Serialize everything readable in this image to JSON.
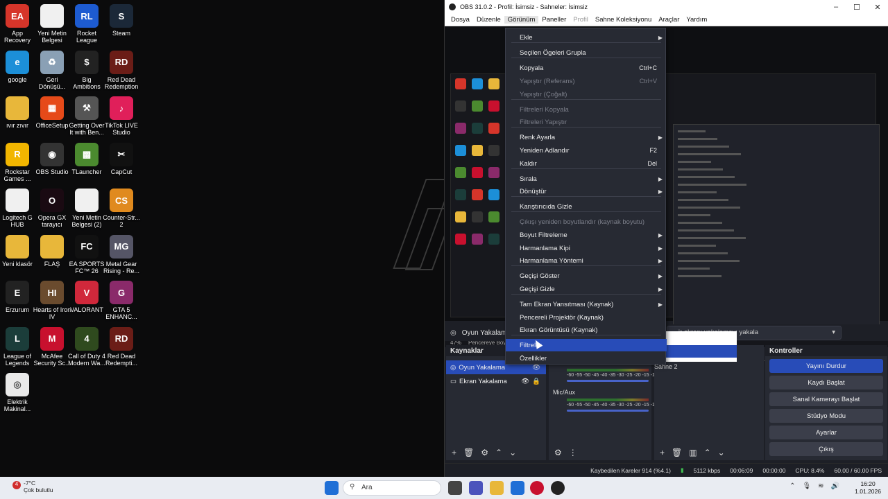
{
  "desktop": {
    "icons": [
      {
        "label": "App\nRecovery",
        "color": "#d6352a",
        "glyph": "EA"
      },
      {
        "label": "Yeni Metin\nBelgesi",
        "color": "#f0f0f0",
        "glyph": ""
      },
      {
        "label": "Rocket\nLeague",
        "color": "#1d5bd1",
        "glyph": "RL"
      },
      {
        "label": "Steam",
        "color": "#1b2838",
        "glyph": "S"
      },
      {
        "label": "google",
        "color": "#1c8fd8",
        "glyph": "e"
      },
      {
        "label": "Geri\nDönüşü...",
        "color": "#8aa0b5",
        "glyph": "♻"
      },
      {
        "label": "Big\nAmbitions",
        "color": "#222",
        "glyph": "$"
      },
      {
        "label": "Red Dead\nRedemption",
        "color": "#6b1d17",
        "glyph": "RD"
      },
      {
        "label": "ıvır zıvır",
        "color": "#e8b73a",
        "glyph": ""
      },
      {
        "label": "OfficeSetup",
        "color": "#e64a19",
        "glyph": "▦"
      },
      {
        "label": "Getting Over\nIt with Ben...",
        "color": "#555",
        "glyph": "⚒"
      },
      {
        "label": "TikTok LIVE\nStudio",
        "color": "#e01f5a",
        "glyph": "♪"
      },
      {
        "label": "Rockstar\nGames ...",
        "color": "#f2b600",
        "glyph": "R"
      },
      {
        "label": "OBS Studio",
        "color": "#333",
        "glyph": "◉"
      },
      {
        "label": "TLauncher",
        "color": "#4b8a2f",
        "glyph": "▩"
      },
      {
        "label": "CapCut",
        "color": "#111",
        "glyph": "✂"
      },
      {
        "label": "Logitech G\nHUB",
        "color": "#f0f0f0",
        "glyph": ""
      },
      {
        "label": "Opera GX\ntarayıcı",
        "color": "#1a0a12",
        "glyph": "O"
      },
      {
        "label": "Yeni Metin\nBelgesi (2)",
        "color": "#f0f0f0",
        "glyph": ""
      },
      {
        "label": "Counter-Str...\n2",
        "color": "#e08a1e",
        "glyph": "CS"
      },
      {
        "label": "Yeni klasör",
        "color": "#e8b73a",
        "glyph": ""
      },
      {
        "label": "FLAŞ",
        "color": "#e8b73a",
        "glyph": ""
      },
      {
        "label": "EA SPORTS\nFC™ 26",
        "color": "#111",
        "glyph": "FC"
      },
      {
        "label": "Metal Gear\nRising - Re...",
        "color": "#556",
        "glyph": "MG"
      },
      {
        "label": "Erzurum",
        "color": "#222",
        "glyph": "E"
      },
      {
        "label": "Hearts of Iron\nIV",
        "color": "#6a4b2e",
        "glyph": "HI"
      },
      {
        "label": "VALORANT",
        "color": "#d0283b",
        "glyph": "V"
      },
      {
        "label": "GTA 5\nENHANC...",
        "color": "#8a2a6a",
        "glyph": "G"
      },
      {
        "label": "League of\nLegends",
        "color": "#1b3d3a",
        "glyph": "L"
      },
      {
        "label": "McAfee\nSecurity Sc...",
        "color": "#c8102e",
        "glyph": "M"
      },
      {
        "label": "Call of Duty 4\nModern Wa...",
        "color": "#2f4a1e",
        "glyph": "4"
      },
      {
        "label": "Red Dead\nRedempti...",
        "color": "#6b1d17",
        "glyph": "RD"
      },
      {
        "label": "Elektrik\nMakinal...",
        "color": "#e9e9e9",
        "glyph": "◎"
      }
    ]
  },
  "obs": {
    "title": "OBS 31.0.2 - Profil: İsimsiz - Sahneler: İsimsiz",
    "menu": [
      "Dosya",
      "Düzenle",
      "Görünüm",
      "Paneller",
      "Profil",
      "Sahne Koleksiyonu",
      "Araçlar",
      "Yardım"
    ],
    "zoom": "47%",
    "zoom_label": "Pencereye Boyu",
    "source_bar_name": "Oyun Yakalama",
    "source_bar_combo": "...ir ekranı yakalamayı yakala",
    "sources_header": "Kaynaklar",
    "sources": [
      "Oyun Yakalama",
      "Ekran Yakalama"
    ],
    "mixer_channel": "Mic/Aux",
    "mixer_scale": "-60 -55 -50 -45 -40 -35 -30 -25 -20 -15 -10 -5 0",
    "scene_item": "Sahne 2",
    "controls_header": "Kontroller",
    "controls": [
      "Yayını Durdur",
      "Kaydı Başlat",
      "Sanal Kamerayı Başlat",
      "Stüdyo Modu",
      "Ayarlar",
      "Çıkış"
    ],
    "status": {
      "dropped": "Kaybedilen Kareler 914 (%4.1)",
      "bitrate": "5112 kbps",
      "stream_time": "00:06:09",
      "rec_time": "00:00:00",
      "cpu": "CPU: 8.4%",
      "fps": "60.00 / 60.00 FPS"
    }
  },
  "context_menu": {
    "items": [
      {
        "label": "Ekle",
        "shortcut": "",
        "arrow": true,
        "disabled": false,
        "y": 0
      },
      {
        "label": "Seçilen Ögeleri Grupla",
        "shortcut": "",
        "arrow": false,
        "disabled": false,
        "y": 1
      },
      {
        "label": "Kopyala",
        "shortcut": "Ctrl+C",
        "arrow": false,
        "disabled": false,
        "y": 2
      },
      {
        "label": "Yapıştır (Referans)",
        "shortcut": "Ctrl+V",
        "arrow": false,
        "disabled": true,
        "y": 3
      },
      {
        "label": "Yapıştır (Çoğalt)",
        "shortcut": "",
        "arrow": false,
        "disabled": true,
        "y": 4
      },
      {
        "label": "Filtreleri Kopyala",
        "shortcut": "",
        "arrow": false,
        "disabled": true,
        "y": 5
      },
      {
        "label": "Filtreleri Yapıştır",
        "shortcut": "",
        "arrow": false,
        "disabled": true,
        "y": 6
      },
      {
        "label": "Renk Ayarla",
        "shortcut": "",
        "arrow": true,
        "disabled": false,
        "y": 7
      },
      {
        "label": "Yeniden Adlandır",
        "shortcut": "F2",
        "arrow": false,
        "disabled": false,
        "y": 8
      },
      {
        "label": "Kaldır",
        "shortcut": "Del",
        "arrow": false,
        "disabled": false,
        "y": 9
      },
      {
        "label": "Sırala",
        "shortcut": "",
        "arrow": true,
        "disabled": false,
        "y": 10
      },
      {
        "label": "Dönüştür",
        "shortcut": "",
        "arrow": true,
        "disabled": false,
        "y": 11
      },
      {
        "label": "Karıştırıcıda Gizle",
        "shortcut": "",
        "arrow": false,
        "disabled": false,
        "y": 12
      },
      {
        "label": "Çıkışı yeniden boyutlandır (kaynak boyutu)",
        "shortcut": "",
        "arrow": false,
        "disabled": true,
        "y": 13
      },
      {
        "label": "Boyut Filtreleme",
        "shortcut": "",
        "arrow": true,
        "disabled": false,
        "y": 14
      },
      {
        "label": "Harmanlama Kipi",
        "shortcut": "",
        "arrow": true,
        "disabled": false,
        "y": 15
      },
      {
        "label": "Harmanlama Yöntemi",
        "shortcut": "",
        "arrow": true,
        "disabled": false,
        "y": 16
      },
      {
        "label": "Geçişi Göster",
        "shortcut": "",
        "arrow": true,
        "disabled": false,
        "y": 17
      },
      {
        "label": "Geçişi Gizle",
        "shortcut": "",
        "arrow": true,
        "disabled": false,
        "y": 18
      },
      {
        "label": "Tam Ekran Yansıtması (Kaynak)",
        "shortcut": "",
        "arrow": true,
        "disabled": false,
        "y": 19
      },
      {
        "label": "Pencereli Projektör (Kaynak)",
        "shortcut": "",
        "arrow": false,
        "disabled": false,
        "y": 20
      },
      {
        "label": "Ekran Görüntüsü (Kaynak)",
        "shortcut": "",
        "arrow": false,
        "disabled": false,
        "y": 21
      },
      {
        "label": "Filtreler",
        "shortcut": "",
        "arrow": false,
        "disabled": false,
        "highlighted": true,
        "y": 22
      },
      {
        "label": "Özellikler",
        "shortcut": "",
        "arrow": false,
        "disabled": false,
        "y": 23
      }
    ]
  },
  "taskbar": {
    "weather_temp": "-7°C",
    "weather_desc": "Çok bulutlu",
    "search_placeholder": "Ara",
    "time": "16:20",
    "date": "1.01.2026",
    "notif_count": "4"
  }
}
